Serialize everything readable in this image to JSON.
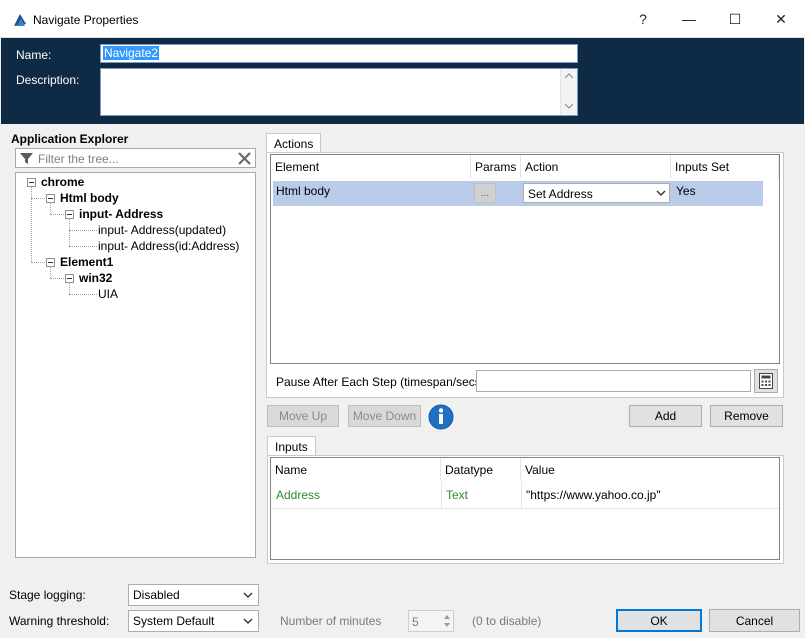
{
  "window": {
    "title": "Navigate Properties",
    "help_glyph": "?",
    "minimize_glyph": "—",
    "maximize_glyph": "☐",
    "close_glyph": "✕"
  },
  "header": {
    "name_label": "Name:",
    "name_value": "Navigate2",
    "description_label": "Description:",
    "description_value": ""
  },
  "explorer": {
    "title": "Application Explorer",
    "filter_placeholder": "Filter the tree...",
    "tree": {
      "chrome": "chrome",
      "html_body": "Html body",
      "input_address": "input- Address",
      "input_address_updated": "input- Address(updated)",
      "input_address_id": "input- Address(id:Address)",
      "element1": "Element1",
      "win32": "win32",
      "uia": "UIA"
    }
  },
  "actions": {
    "tab_label": "Actions",
    "columns": [
      "Element",
      "Params",
      "Action",
      "Inputs Set"
    ],
    "rows": [
      {
        "element": "Html body",
        "params_button": "...",
        "action": "Set Address",
        "inputs_set": "Yes"
      }
    ],
    "pause_label": "Pause After Each Step (timespan/secs)",
    "pause_value": "",
    "move_up": "Move Up",
    "move_down": "Move Down",
    "add": "Add",
    "remove": "Remove"
  },
  "inputs": {
    "tab_label": "Inputs",
    "columns": [
      "Name",
      "Datatype",
      "Value"
    ],
    "rows": [
      {
        "name": "Address",
        "datatype": "Text",
        "value": "\"https://www.yahoo.co.jp\""
      }
    ]
  },
  "footer": {
    "stage_logging_label": "Stage logging:",
    "stage_logging_value": "Disabled",
    "warning_label": "Warning threshold:",
    "warning_value": "System Default",
    "minutes_label": "Number of minutes",
    "minutes_value": "5",
    "disable_hint": "(0 to disable)",
    "ok": "OK",
    "cancel": "Cancel"
  },
  "colors": {
    "header_bg": "#0f2a44",
    "selected_row": "#b8cbe8",
    "accent": "#0078d7",
    "input_name_green": "#2d8a2d"
  }
}
